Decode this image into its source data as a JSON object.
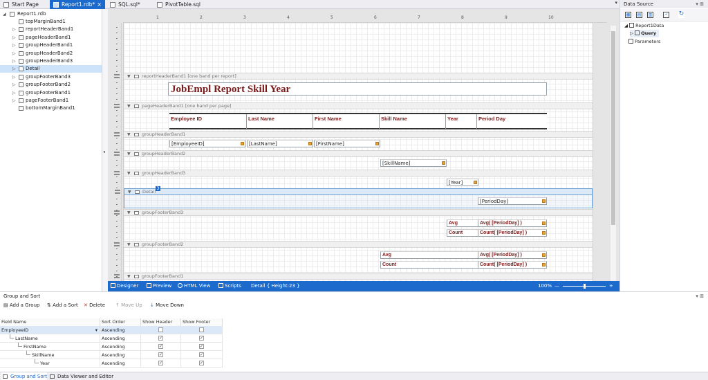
{
  "tabs": [
    {
      "label": "Start Page",
      "active": false
    },
    {
      "label": "Report1.rdb*",
      "active": true,
      "close": "×"
    },
    {
      "label": "SQL.sql*",
      "active": false
    },
    {
      "label": "PivotTable.sql",
      "active": false
    }
  ],
  "tab_dropdown": "▾",
  "tree": {
    "root": "Report1.rdb",
    "items": [
      "topMarginBand1",
      "reportHeaderBand1",
      "pageHeaderBand1",
      "groupHeaderBand1",
      "groupHeaderBand2",
      "groupHeaderBand3",
      "Detail",
      "groupFooterBand3",
      "groupFooterBand2",
      "groupFooterBand1",
      "pageFooterBand1",
      "bottomMarginBand1"
    ],
    "selected": "Detail"
  },
  "ruler": [
    "1",
    "2",
    "3",
    "4",
    "5",
    "6",
    "7",
    "8",
    "9",
    "10"
  ],
  "bands": {
    "reportHeader": "reportHeaderBand1 [one band per report]",
    "pageHeader": "pageHeaderBand1 [one band per page]",
    "gh1": "groupHeaderBand1",
    "gh2": "groupHeaderBand2",
    "gh3": "groupHeaderBand3",
    "detail": "Detail",
    "gf3": "groupFooterBand3",
    "gf2": "groupFooterBand2",
    "gf1": "groupFooterBand1"
  },
  "detail_badge": "3",
  "report_title": "JobEmpl Report Skill Year",
  "headers": [
    "Employee ID",
    "Last Name",
    "First Name",
    "Skill Name",
    "Year",
    "Period Day"
  ],
  "fields": {
    "employeeId": "[EmployeeID]",
    "lastName": "[LastName]",
    "firstName": "[FirstName]",
    "skillName": "[SkillName]",
    "year": "[Year]",
    "periodDay": "[PeriodDay]"
  },
  "footer3": {
    "avg": "Avg",
    "avg_expr": "Avg( [PeriodDay] )",
    "count": "Count",
    "count_expr": "Count( [PeriodDay] )"
  },
  "footer2": {
    "avg": "Avg",
    "avg_expr": "Avg( [PeriodDay] )",
    "count": "Count",
    "count_expr": "Count( [PeriodDay] )"
  },
  "statusbar": {
    "designer": "Designer",
    "preview": "Preview",
    "html": "HTML View",
    "scripts": "Scripts",
    "info": "Detail { Height:23 }",
    "zoom": "100%",
    "minus": "—",
    "plus": "+"
  },
  "datasource": {
    "title": "Data Source",
    "root": "Report1Data",
    "query": "Query",
    "params": "Parameters"
  },
  "groupsort": {
    "title": "Group and Sort",
    "add_group": "Add a Group",
    "add_sort": "Add a Sort",
    "delete": "Delete",
    "move_up": "Move Up",
    "move_down": "Move Down",
    "columns": [
      "Field Name",
      "Sort Order",
      "Show Header",
      "Show Footer"
    ],
    "rows": [
      {
        "field": "EmployeeID",
        "order": "Ascending",
        "header": false,
        "footer": false,
        "indent": 0
      },
      {
        "field": "LastName",
        "order": "Ascending",
        "header": true,
        "footer": true,
        "indent": 1
      },
      {
        "field": "FirstName",
        "order": "Ascending",
        "header": true,
        "footer": true,
        "indent": 2
      },
      {
        "field": "SkillName",
        "order": "Ascending",
        "header": true,
        "footer": true,
        "indent": 3
      },
      {
        "field": "Year",
        "order": "Ascending",
        "header": true,
        "footer": true,
        "indent": 4
      }
    ],
    "dropdown_glyph": "▾",
    "check_glyph": "✓"
  },
  "bottom_tabs": [
    "Group and Sort",
    "Data Viewer and Editor"
  ],
  "glyphs": {
    "pin": "▾ ⊞",
    "collapse": "◂",
    "tri": "▼",
    "expand": "▷",
    "x": "✕",
    "arrow_up": "↑",
    "arrow_down": "↓",
    "plus": "+"
  },
  "colors": {
    "accent": "#1c6bcc",
    "title_red": "#7b1a1a",
    "field_tag": "#e8a23a"
  }
}
